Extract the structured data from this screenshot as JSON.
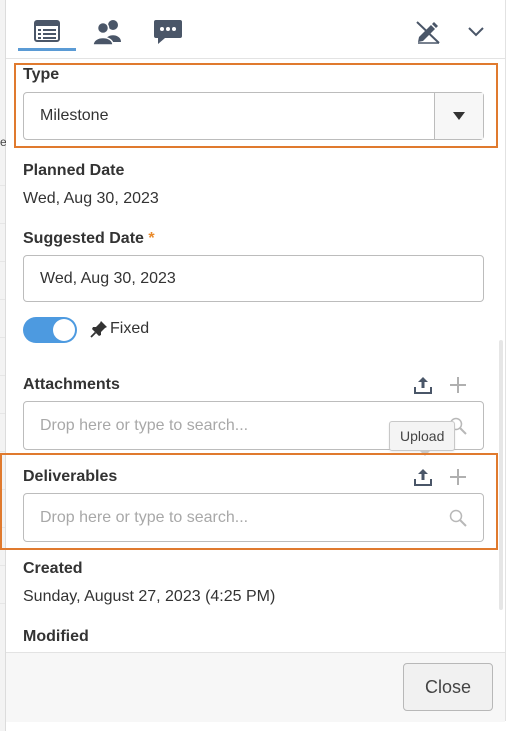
{
  "left_edge": {
    "mark": "e"
  },
  "toolbar": {
    "items": [
      {
        "icon": "details-list-icon"
      },
      {
        "icon": "people-icon"
      },
      {
        "icon": "chat-icon"
      },
      {
        "icon": "hide-pen-icon"
      },
      {
        "icon": "chevron-down-icon"
      }
    ],
    "active_color": "#5b9bd5"
  },
  "type": {
    "label": "Type",
    "value": "Milestone"
  },
  "planned_date": {
    "label": "Planned Date",
    "value": "Wed, Aug 30, 2023"
  },
  "suggested_date": {
    "label": "Suggested Date",
    "required_mark": "*",
    "value": "Wed, Aug 30, 2023"
  },
  "fixed": {
    "on": true,
    "label": "Fixed"
  },
  "attachments": {
    "label": "Attachments",
    "placeholder": "Drop here or type to search..."
  },
  "tooltip": {
    "text": "Upload"
  },
  "deliverables": {
    "label": "Deliverables",
    "placeholder": "Drop here or type to search..."
  },
  "created": {
    "label": "Created",
    "value": "Sunday, August 27, 2023 (4:25 PM)"
  },
  "modified": {
    "label": "Modified"
  },
  "footer": {
    "close_label": "Close"
  },
  "colors": {
    "accent": "#4d9ae0",
    "highlight": "#e07a2e",
    "required": "#e98a2b"
  }
}
